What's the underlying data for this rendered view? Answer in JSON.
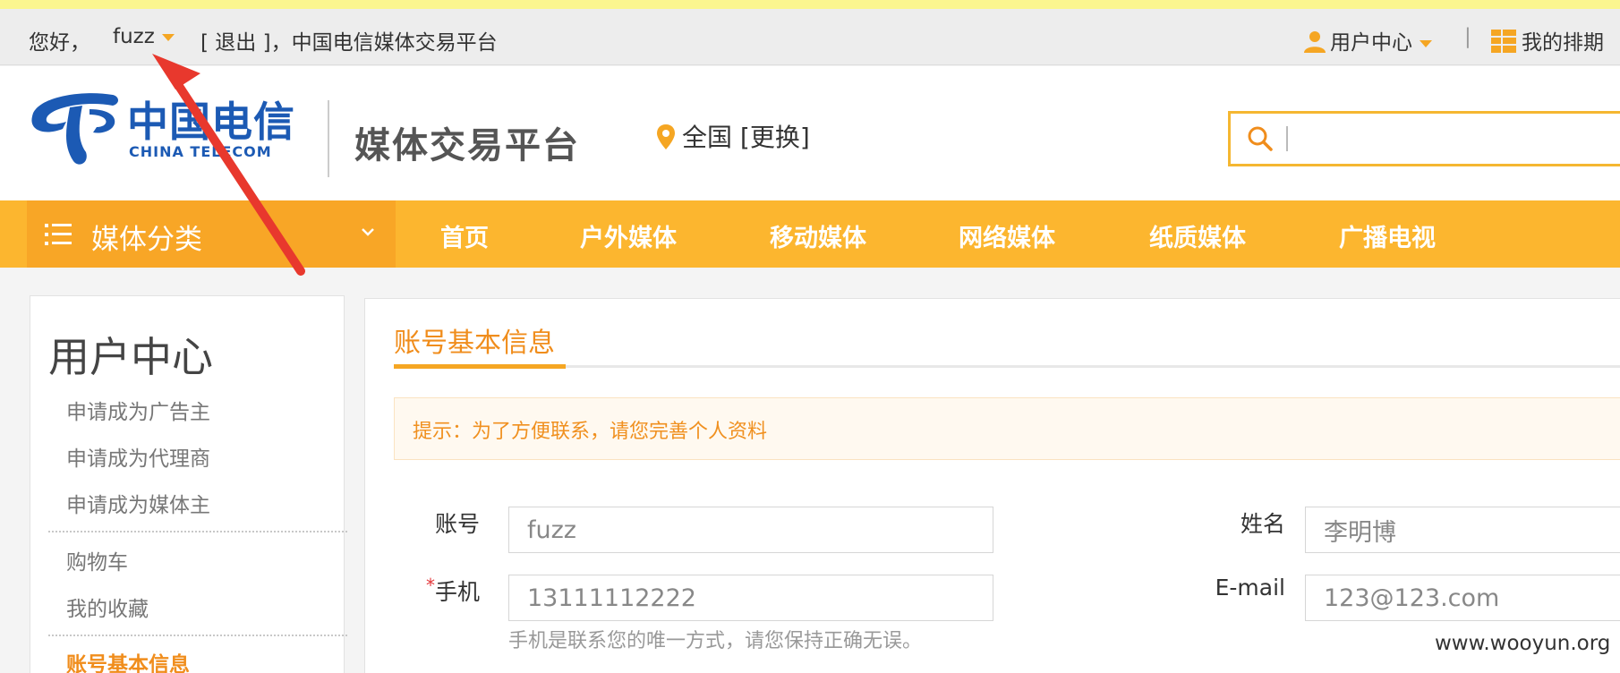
{
  "topbar": {
    "greeting": "您好，",
    "username": "fuzz",
    "logout": "[ 退出 ]，中国电信媒体交易平台",
    "user_center": "用户中心",
    "separator": "|",
    "my_schedule": "我的排期"
  },
  "header": {
    "logo_cn": "中国电信",
    "logo_en": "CHINA TELECOM",
    "platform": "媒体交易平台",
    "region": "全国 [更换]",
    "search_placeholder": ""
  },
  "nav": {
    "category": "媒体分类",
    "links": [
      "首页",
      "户外媒体",
      "移动媒体",
      "网络媒体",
      "纸质媒体",
      "广播电视"
    ]
  },
  "sidebar": {
    "title": "用户中心",
    "items": [
      "申请成为广告主",
      "申请成为代理商",
      "申请成为媒体主",
      "购物车",
      "我的收藏",
      "账号基本信息"
    ]
  },
  "main": {
    "title": "账号基本信息",
    "notice": "提示：为了方便联系，请您完善个人资料",
    "fields": {
      "account_label": "账号",
      "account_value": "fuzz",
      "name_label": "姓名",
      "name_value": "李明博",
      "phone_label": "手机",
      "phone_required": "*",
      "phone_value": "13111112222",
      "email_label": "E-mail",
      "email_value": "123@123.com",
      "phone_hint": "手机是联系您的唯一方式，请您保持正确无误。"
    }
  },
  "watermark": "www.wooyun.org",
  "colors": {
    "accent_orange": "#f5a623",
    "nav_bg": "#fcb62f",
    "annotation_red": "#e8382d",
    "brand_blue": "#1c5ab4"
  }
}
